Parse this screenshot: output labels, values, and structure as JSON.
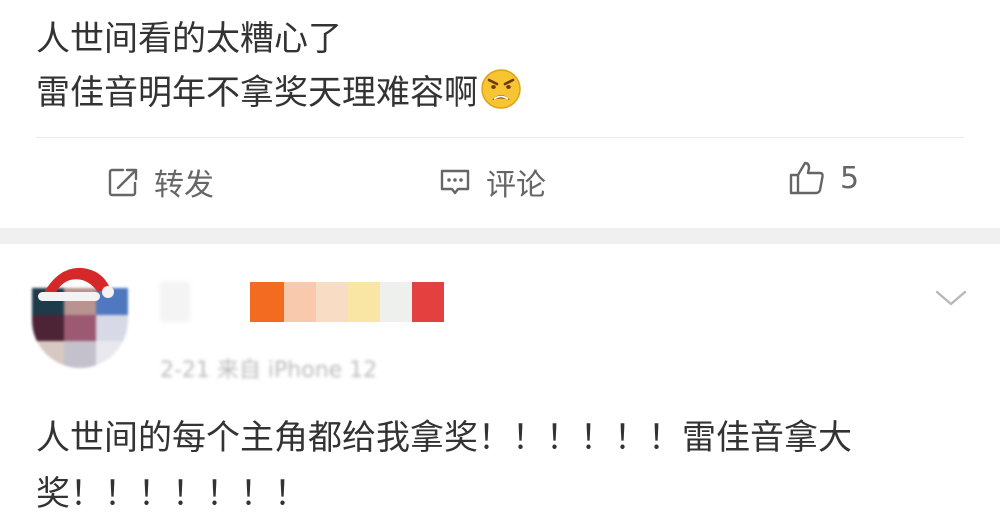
{
  "post1": {
    "lines": [
      "人世间看的太糟心了",
      "雷佳音明年不拿奖天理难容啊"
    ],
    "emoji": "angry-face-icon"
  },
  "actions": {
    "repost_label": "转发",
    "comment_label": "评论",
    "like_count": "5"
  },
  "post2": {
    "meta": "2-21 来自 iPhone 12",
    "text": "人世间的每个主角都给我拿奖！！！！！！雷佳音拿大奖！！！！！！！"
  },
  "colors": {
    "text": "#333333",
    "secondary": "#666666",
    "separator": "#f0f0f0"
  }
}
